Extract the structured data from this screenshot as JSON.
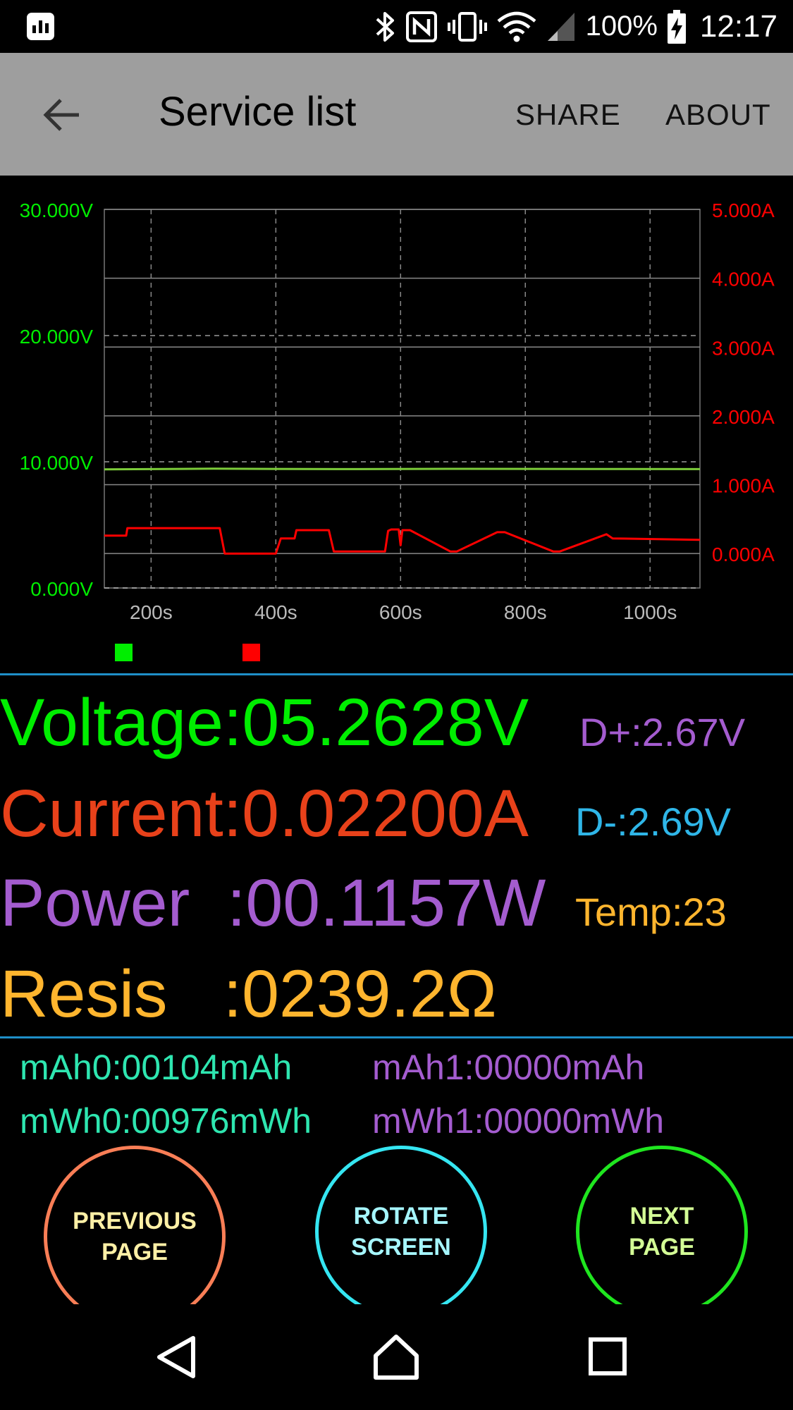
{
  "status_bar": {
    "battery": "100%",
    "time": "12:17",
    "icons": [
      "app-monitor-icon",
      "bluetooth-icon",
      "nfc-icon",
      "vibrate-icon",
      "wifi-icon",
      "signal-icon",
      "battery-charging-icon"
    ]
  },
  "app_bar": {
    "title": "Service list",
    "share": "SHARE",
    "about": "ABOUT"
  },
  "chart_data": {
    "type": "line",
    "x_ticks": [
      "200s",
      "400s",
      "600s",
      "800s",
      "1000s"
    ],
    "x_tick_values": [
      200,
      400,
      600,
      800,
      1000
    ],
    "xlim": [
      125,
      1080
    ],
    "left_axis": {
      "ticks": [
        "0.000V",
        "10.000V",
        "20.000V",
        "30.000V"
      ],
      "ylim": [
        0,
        30
      ],
      "color": "#00ee00"
    },
    "right_axis": {
      "ticks": [
        "0.000A",
        "1.000A",
        "2.000A",
        "3.000A",
        "4.000A",
        "5.000A"
      ],
      "ylim": [
        -0.5,
        5
      ],
      "color": "#ff0000"
    },
    "series": [
      {
        "axis": "left",
        "color": "#7ccc3a",
        "x": [
          125,
          300,
          500,
          700,
          900,
          1080
        ],
        "y": [
          9.4,
          9.45,
          9.42,
          9.44,
          9.43,
          9.42
        ]
      },
      {
        "axis": "right",
        "color": "#ff0000",
        "x": [
          125,
          160,
          162,
          310,
          318,
          400,
          408,
          430,
          433,
          485,
          493,
          575,
          580,
          585,
          597,
          600,
          603,
          615,
          680,
          690,
          755,
          767,
          845,
          855,
          930,
          940,
          1080
        ],
        "y": [
          0.26,
          0.26,
          0.37,
          0.37,
          0.0,
          0.0,
          0.22,
          0.22,
          0.34,
          0.34,
          0.03,
          0.03,
          0.33,
          0.35,
          0.35,
          0.12,
          0.34,
          0.34,
          0.03,
          0.03,
          0.31,
          0.31,
          0.03,
          0.03,
          0.28,
          0.22,
          0.2
        ]
      }
    ],
    "legend": [
      "#00ee00",
      "#ff0000"
    ]
  },
  "readings": {
    "voltage": "Voltage:05.2628V",
    "current": "Current:0.02200A",
    "power": "Power  :00.1157W",
    "resis": "Resis   :0239.2Ω",
    "dplus": "D+:2.67V",
    "dminus": "D-:2.69V",
    "temp": "Temp:23"
  },
  "colors": {
    "voltage": "#00ee00",
    "current": "#e8411a",
    "power": "#a45ccf",
    "resis": "#ffb52e",
    "dplus": "#a45ccf",
    "dminus": "#2fb6e8",
    "temp": "#ffb52e",
    "group0": "#2ee6b0",
    "group1": "#a45ccf"
  },
  "stats": {
    "mah0": "mAh0:00104mAh",
    "mah1": "mAh1:00000mAh",
    "mwh0": "mWh0:00976mWh",
    "mwh1": "mWh1:00000mWh"
  },
  "buttons": {
    "previous": {
      "line1": "PREVIOUS",
      "line2": "PAGE",
      "ring": "#f97e56",
      "text": "#fff0a6"
    },
    "rotate": {
      "line1": "ROTATE",
      "line2": "SCREEN",
      "ring": "#35e6f2",
      "text": "#a6f6ff"
    },
    "next": {
      "line1": "NEXT",
      "line2": "PAGE",
      "ring": "#1fe61f",
      "text": "#d4ff96"
    }
  },
  "nav": {
    "icons": [
      "back-icon",
      "home-icon",
      "recents-icon"
    ]
  }
}
